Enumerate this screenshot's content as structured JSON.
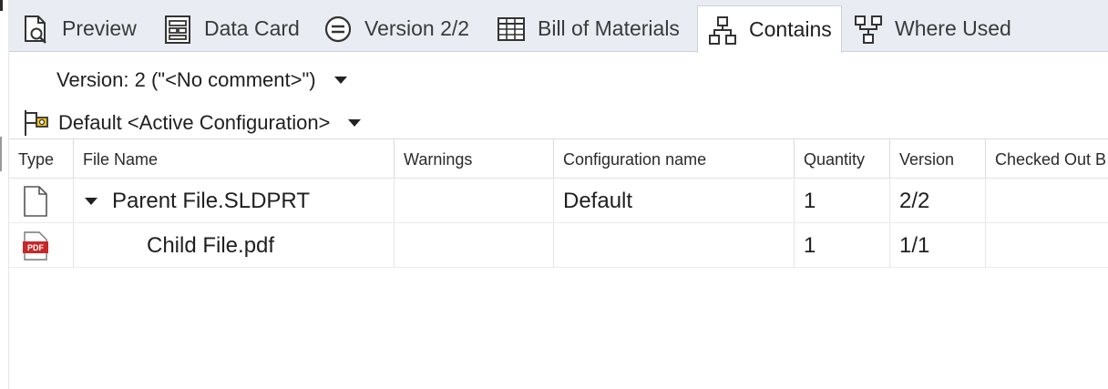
{
  "tabs": [
    {
      "label": "Preview",
      "icon": "preview-icon"
    },
    {
      "label": "Data Card",
      "icon": "data-card-icon"
    },
    {
      "label": "Version 2/2",
      "icon": "version-icon"
    },
    {
      "label": "Bill of Materials",
      "icon": "bill-of-materials-icon"
    },
    {
      "label": "Contains",
      "icon": "contains-icon",
      "active": true
    },
    {
      "label": "Where Used",
      "icon": "where-used-icon"
    }
  ],
  "version_selector": {
    "label": "Version: 2 (\"<No comment>\")"
  },
  "config_selector": {
    "label": "Default <Active Configuration>",
    "icon": "configuration-flag-icon"
  },
  "grid": {
    "columns": [
      "Type",
      "File Name",
      "Warnings",
      "Configuration name",
      "Quantity",
      "Version",
      "Checked Out B"
    ],
    "rows": [
      {
        "type_icon": "document-icon",
        "file_name": "Parent File.SLDPRT",
        "warnings": "",
        "configuration": "Default",
        "quantity": "1",
        "version": "2/2",
        "checked_out_by": "",
        "expanded": true
      },
      {
        "type_icon": "pdf-icon",
        "pdf_badge": "PDF",
        "file_name": "Child File.pdf",
        "warnings": "",
        "configuration": "",
        "quantity": "1",
        "version": "1/1",
        "checked_out_by": ""
      }
    ]
  },
  "colors": {
    "tabbar_bg": "#e9edf3",
    "active_tab_bg": "#ffffff",
    "pdf_red": "#c62828",
    "accent_blue": "#2e6db4"
  }
}
